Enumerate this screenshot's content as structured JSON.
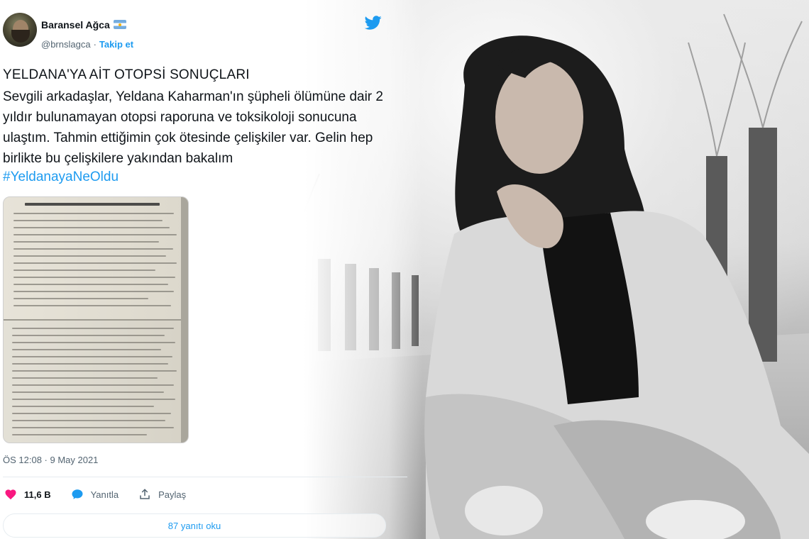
{
  "tweet": {
    "display_name": "Baransel Ağca",
    "handle": "@brnslagca",
    "separator": "·",
    "follow_label": "Takip et",
    "title": "YELDANA'YA AİT OTOPSİ SONUÇLARI",
    "body": "Sevgili arkadaşlar, Yeldana Kaharman'ın şüpheli ölümüne dair 2 yıldır bulunamayan otopsi raporuna ve toksikoloji sonucuna ulaştım. Tahmin ettiğimin çok ötesinde çelişkiler var. Gelin hep birlikte bu çelişkilere yakından bakalım",
    "hashtag": "#YeldanayaNeOldu",
    "timestamp": "ÖS 12:08 · 9 May 2021",
    "like_count": "11,6 B",
    "reply_label": "Yanıtla",
    "share_label": "Paylaş",
    "replies_button": "87 yanıtı oku"
  },
  "colors": {
    "accent": "#1d9bf0",
    "like": "#f91880",
    "text": "#0f1419",
    "muted": "#536471"
  },
  "icons": {
    "brand": "twitter-bird-icon",
    "flag": "argentina-flag-icon",
    "like": "heart-icon",
    "reply": "speech-bubble-icon",
    "share": "share-icon"
  }
}
